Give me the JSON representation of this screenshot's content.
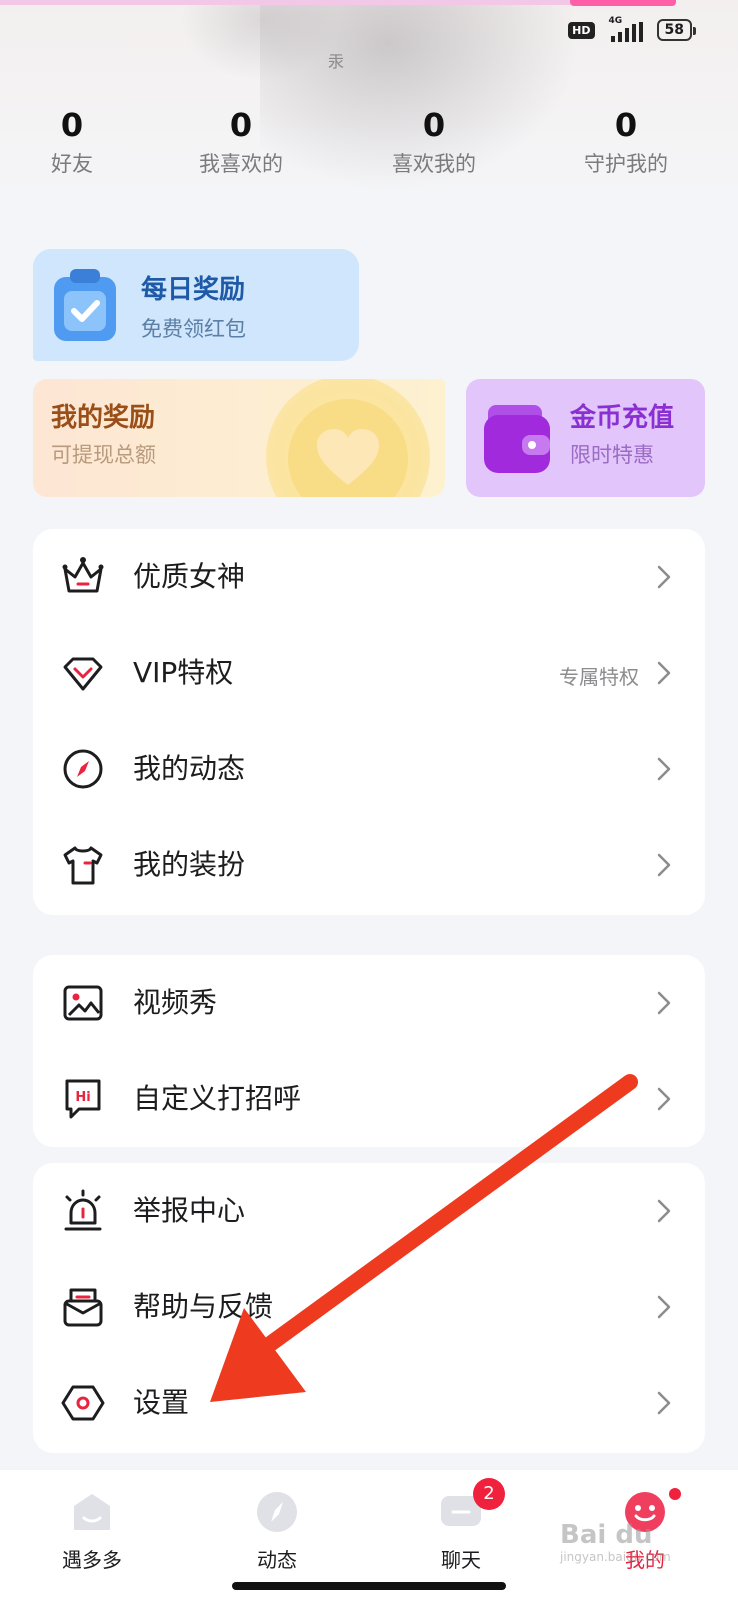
{
  "status_bar": {
    "hd": "HD",
    "network": "4G",
    "battery": "58"
  },
  "header": {
    "partial_text": "汞"
  },
  "stats": [
    {
      "value": "0",
      "label": "好友"
    },
    {
      "value": "0",
      "label": "我喜欢的"
    },
    {
      "value": "0",
      "label": "喜欢我的"
    },
    {
      "value": "0",
      "label": "守护我的"
    }
  ],
  "cards": {
    "daily": {
      "title": "每日奖励",
      "subtitle": "免费领红包",
      "title_color": "#1e5aa8",
      "sub_color": "#5b7fa6"
    },
    "reward": {
      "title": "我的奖励",
      "subtitle": "可提现总额",
      "title_color": "#9a4f19",
      "sub_color": "#b89a7c"
    },
    "coins": {
      "title": "金币充值",
      "subtitle": "限时特惠",
      "title_color": "#8a2fd1",
      "sub_color": "#9c6cc4"
    }
  },
  "menu_groups": [
    {
      "items": [
        {
          "label": "优质女神",
          "icon": "crown-icon"
        },
        {
          "label": "VIP特权",
          "icon": "diamond-icon",
          "extra": "专属特权"
        },
        {
          "label": "我的动态",
          "icon": "compass-icon"
        },
        {
          "label": "我的装扮",
          "icon": "tshirt-icon"
        }
      ]
    },
    {
      "items": [
        {
          "label": "视频秀",
          "icon": "image-icon"
        },
        {
          "label": "自定义打招呼",
          "icon": "hi-message-icon"
        }
      ]
    },
    {
      "items": [
        {
          "label": "举报中心",
          "icon": "alarm-icon"
        },
        {
          "label": "帮助与反馈",
          "icon": "mail-icon"
        },
        {
          "label": "设置",
          "icon": "settings-hexagon-icon"
        }
      ]
    }
  ],
  "tabbar": [
    {
      "label": "遇多多",
      "icon": "home-icon"
    },
    {
      "label": "动态",
      "icon": "moments-icon"
    },
    {
      "label": "聊天",
      "icon": "chat-icon",
      "badge": "2"
    },
    {
      "label": "我的",
      "icon": "profile-icon"
    }
  ],
  "watermark": {
    "text": "Bai du",
    "sub": "jingyan.baidu.com"
  },
  "colors": {
    "accent_red": "#e8243f",
    "annotation_arrow": "#ee3a1f"
  }
}
